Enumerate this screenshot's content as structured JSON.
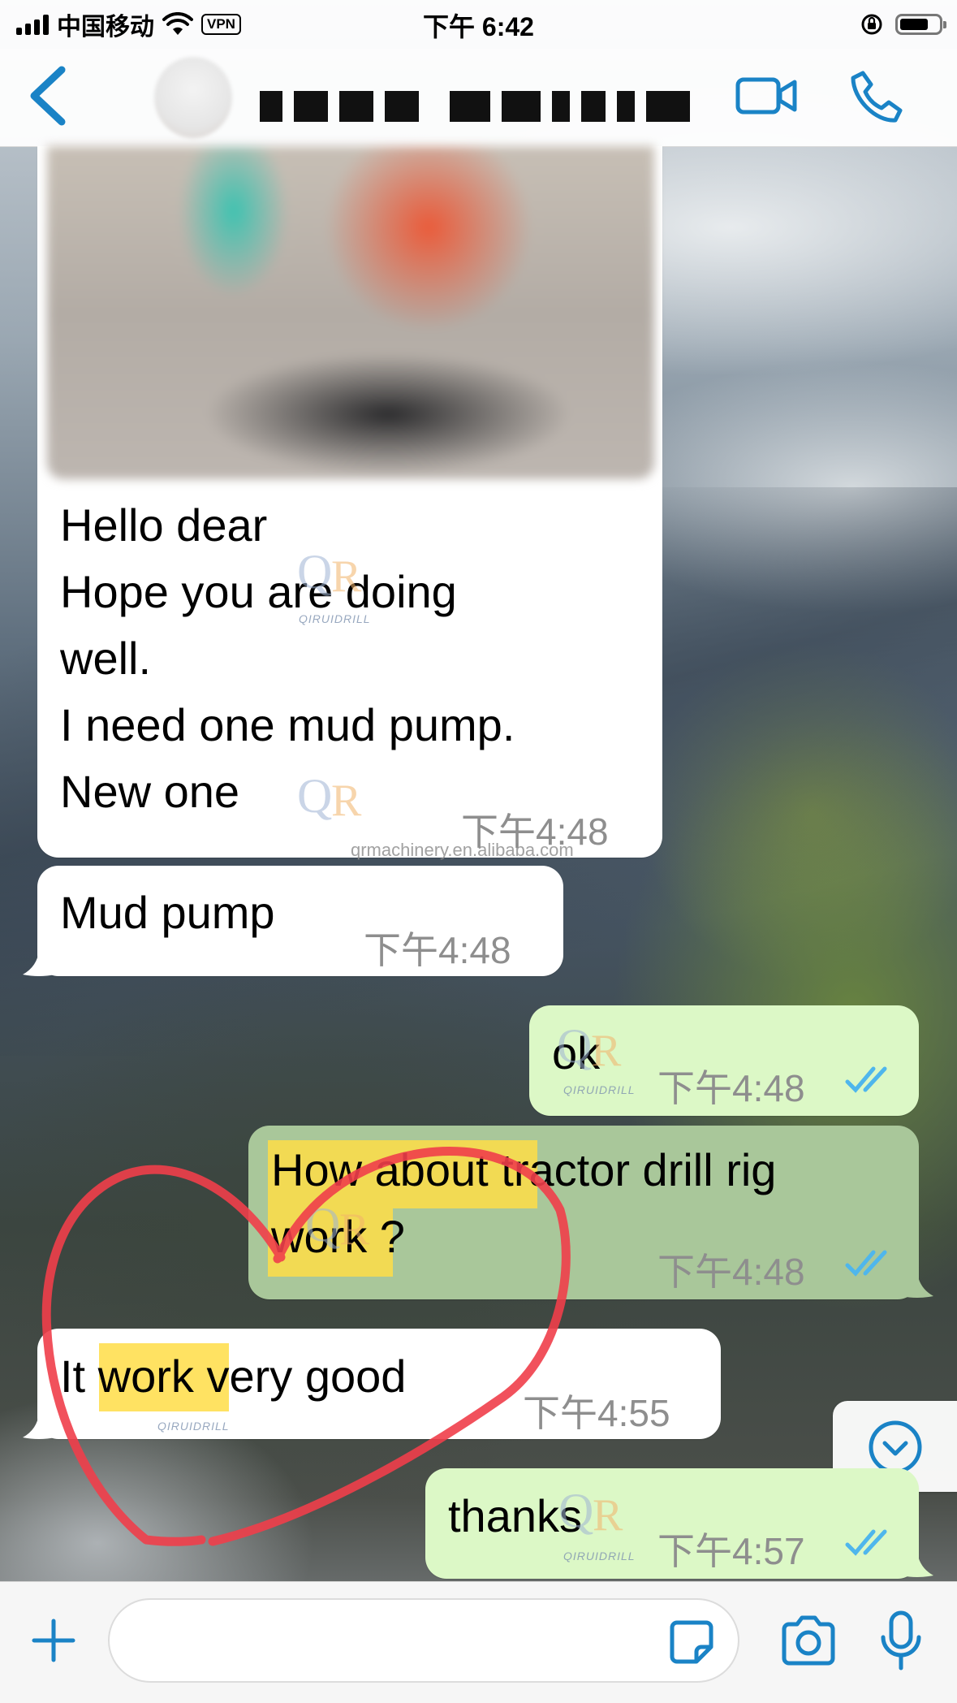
{
  "status_bar": {
    "carrier": "中国移动",
    "vpn": "VPN",
    "time": "下午 6:42"
  },
  "header": {
    "contact_name": "",
    "icons": [
      "back-chevron-icon",
      "avatar",
      "video-camera-icon",
      "phone-icon"
    ]
  },
  "messages": [
    {
      "direction": "incoming",
      "has_image": true,
      "text": "Hello dear\nHope you are doing\nwell.\nI need one mud pump.\nNew one",
      "time": "下午4:48"
    },
    {
      "direction": "incoming",
      "text": "Mud pump",
      "time": "下午4:48"
    },
    {
      "direction": "outgoing",
      "text": "ok",
      "time": "下午4:48",
      "read": true
    },
    {
      "direction": "outgoing",
      "text": "How about tractor drill rig\nwork ?",
      "time": "下午4:48",
      "read": true,
      "highlighted_words": [
        "How about",
        "work"
      ]
    },
    {
      "direction": "incoming",
      "text": "It work very good",
      "time": "下午4:55",
      "highlighted_words": [
        "work"
      ]
    },
    {
      "direction": "outgoing",
      "text": "thanks",
      "time": "下午4:57",
      "read": true
    }
  ],
  "watermark": {
    "brand": "QIRUIDRILL",
    "url": "qrmachinery.en.alibaba.com"
  },
  "input_bar": {
    "placeholder": "",
    "icons": [
      "plus-icon",
      "sticker-icon",
      "camera-icon",
      "microphone-icon"
    ]
  },
  "colors": {
    "accent": "#1a83c6",
    "incoming_bubble": "#ffffff",
    "outgoing_bubble": "#dcf8c6",
    "read_ticks": "#4fb6ec",
    "highlight": "#ffdd46",
    "annotation_heart": "#ef3e4a"
  }
}
